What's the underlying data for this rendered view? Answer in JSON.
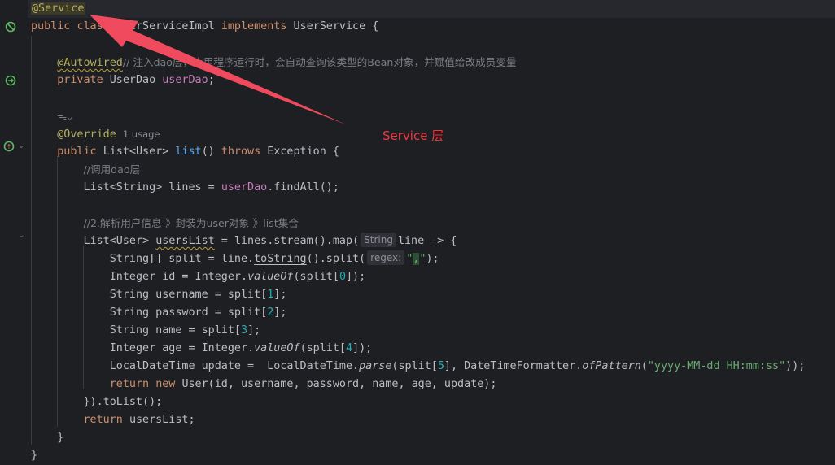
{
  "code": {
    "l1_annotation": "@Service",
    "l2_kw_public": "public",
    "l2_kw_class": "class",
    "l2_classname": "UserServiceImpl",
    "l2_kw_implements": "implements",
    "l2_iface": "UserService {",
    "l4_annotation": "@Autowired",
    "l4_comment": "// 注入dao层，应用程序运行时，会自动查询该类型的Bean对象，并赋值给改成员变量",
    "l5_kw": "private",
    "l5_type": "UserDao",
    "l5_field": "userDao",
    "l5_end": ";",
    "l7_ai": "ᯓ⌄",
    "l8_annotation": "@Override",
    "l8_usage": "1 usage",
    "l9_kw_public": "public",
    "l9_type": "List<User>",
    "l9_method": "list",
    "l9_parens": "()",
    "l9_kw_throws": "throws",
    "l9_exc": "Exception {",
    "l10_comment": "//调用dao层",
    "l11_pre": "List<String> lines = ",
    "l11_field": "userDao",
    "l11_post": ".findAll();",
    "l13_comment": "//2.解析用户信息-》封装为user对象-》list集合",
    "l14_type": "List<User>",
    "l14_var": "usersList",
    "l14_mid": " = lines.stream().map(",
    "l14_hint": "String",
    "l14_post": "line -> {",
    "l15_pre": "String[] split = line.",
    "l15_method": "toString",
    "l15_mid": "().split(",
    "l15_hint": "regex:",
    "l15_str_open": "\"",
    "l15_str_comma": ",",
    "l15_str_close": "\"",
    "l15_end": ");",
    "l16_pre": "Integer id = Integer.",
    "l16_method": "valueOf",
    "l16_mid": "(split[",
    "l16_num": "0",
    "l16_end": "]);",
    "l17_pre": "String username = split[",
    "l17_num": "1",
    "l17_end": "];",
    "l18_pre": "String password = split[",
    "l18_num": "2",
    "l18_end": "];",
    "l19_pre": "String name = split[",
    "l19_num": "3",
    "l19_end": "];",
    "l20_pre": "Integer age = Integer.",
    "l20_method": "valueOf",
    "l20_mid": "(split[",
    "l20_num": "4",
    "l20_end": "]);",
    "l21_pre": "LocalDateTime update =  LocalDateTime.",
    "l21_method": "parse",
    "l21_mid": "(split[",
    "l21_num": "5",
    "l21_mid2": "], DateTimeFormatter.",
    "l21_method2": "ofPattern",
    "l21_open": "(",
    "l21_str": "\"yyyy-MM-dd HH:mm:ss\"",
    "l21_end": "));",
    "l22_kw_return": "return",
    "l22_kw_new": "new",
    "l22_post": "User(id, username, password, name, age, update);",
    "l23": "}).toList();",
    "l24_kw": "return",
    "l24_post": "usersList;",
    "l25": "}",
    "l26": "}"
  },
  "overlay": {
    "label": "Service 层",
    "arrow_color": "#f04a5e"
  },
  "gutter_icons": {
    "line2": "implemented-marker-icon",
    "line5": "bean-injection-icon",
    "line9": "override-marker-icon"
  }
}
